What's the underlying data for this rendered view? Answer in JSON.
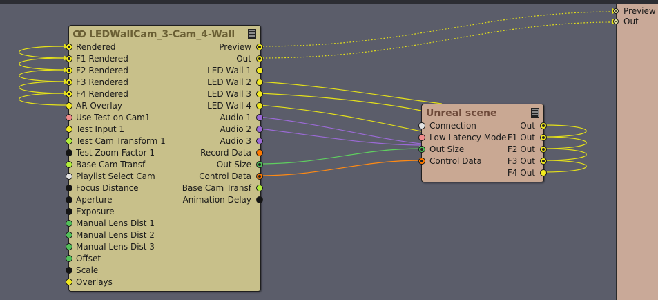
{
  "colors": {
    "yellow": "#f2ea1f",
    "black": "#151515",
    "green": "#52c05a",
    "lime": "#b2ee3c",
    "pink": "#f08a8a",
    "white": "#e2e2e2",
    "purple": "#9b6ad6",
    "orange": "#ff7a00",
    "wire_yellow": "#e4e01a",
    "wire_green": "#5fcf5f",
    "wire_orange": "#ff8a14"
  },
  "led_node": {
    "title": "LEDWallCam_3-Cam_4-Wall",
    "icon": "link-icon",
    "inputs": [
      {
        "label": "Rendered",
        "color": "yellow",
        "connected": true
      },
      {
        "label": "F1 Rendered",
        "color": "yellow",
        "connected": true
      },
      {
        "label": "F2 Rendered",
        "color": "yellow",
        "connected": true
      },
      {
        "label": "F3 Rendered",
        "color": "yellow",
        "connected": true
      },
      {
        "label": "F4 Rendered",
        "color": "yellow",
        "connected": true
      },
      {
        "label": "AR Overlay",
        "color": "yellow",
        "connected": false
      },
      {
        "label": "Use Test on Cam1",
        "color": "pink",
        "connected": false
      },
      {
        "label": "Test Input 1",
        "color": "yellow",
        "connected": false
      },
      {
        "label": "Test Cam Transform 1",
        "color": "lime",
        "connected": false
      },
      {
        "label": "Test Zoom Factor 1",
        "color": "black",
        "connected": false
      },
      {
        "label": "Base Cam Transf",
        "color": "lime",
        "connected": false
      },
      {
        "label": "Playlist Select Cam",
        "color": "white",
        "connected": false
      },
      {
        "label": "Focus Distance",
        "color": "black",
        "connected": false
      },
      {
        "label": "Aperture",
        "color": "black",
        "connected": false
      },
      {
        "label": "Exposure",
        "color": "black",
        "connected": false
      },
      {
        "label": "Manual Lens Dist 1",
        "color": "green",
        "connected": false
      },
      {
        "label": "Manual Lens Dist 2",
        "color": "green",
        "connected": false
      },
      {
        "label": "Manual Lens Dist 3",
        "color": "green",
        "connected": false
      },
      {
        "label": "Offset",
        "color": "green",
        "connected": false
      },
      {
        "label": "Scale",
        "color": "black",
        "connected": false
      },
      {
        "label": "Overlays",
        "color": "yellow",
        "connected": false
      }
    ],
    "outputs": [
      {
        "label": "Preview",
        "color": "yellow",
        "connected": true
      },
      {
        "label": "Out",
        "color": "yellow",
        "connected": true
      },
      {
        "label": "LED Wall 1",
        "color": "yellow",
        "connected": false
      },
      {
        "label": "LED Wall 2",
        "color": "yellow",
        "connected": false
      },
      {
        "label": "LED Wall 3",
        "color": "yellow",
        "connected": false
      },
      {
        "label": "LED Wall 4",
        "color": "yellow",
        "connected": false
      },
      {
        "label": "Audio 1",
        "color": "purple",
        "connected": false
      },
      {
        "label": "Audio 2",
        "color": "purple",
        "connected": false
      },
      {
        "label": "Audio 3",
        "color": "purple",
        "connected": false
      },
      {
        "label": "Record Data",
        "color": "orange",
        "connected": false
      },
      {
        "label": "Out Size",
        "color": "green",
        "connected": true
      },
      {
        "label": "Control Data",
        "color": "orange",
        "connected": true
      },
      {
        "label": "Base Cam Transf",
        "color": "lime",
        "connected": false
      },
      {
        "label": "Animation Delay",
        "color": "black",
        "connected": false
      }
    ]
  },
  "unreal_node": {
    "title": "Unreal scene",
    "inputs": [
      {
        "label": "Connection",
        "color": "white",
        "connected": false
      },
      {
        "label": "Low Latency Mode",
        "color": "pink",
        "connected": false
      },
      {
        "label": "Out Size",
        "color": "green",
        "connected": true
      },
      {
        "label": "Control Data",
        "color": "orange",
        "connected": true
      }
    ],
    "outputs": [
      {
        "label": "Out",
        "color": "yellow",
        "connected": true
      },
      {
        "label": "F1 Out",
        "color": "yellow",
        "connected": true
      },
      {
        "label": "F2 Out",
        "color": "yellow",
        "connected": true
      },
      {
        "label": "F3 Out",
        "color": "yellow",
        "connected": true
      },
      {
        "label": "F4 Out",
        "color": "yellow",
        "connected": false
      }
    ]
  },
  "output_node": {
    "ports": [
      {
        "label": "Preview"
      },
      {
        "label": "Out"
      }
    ]
  }
}
